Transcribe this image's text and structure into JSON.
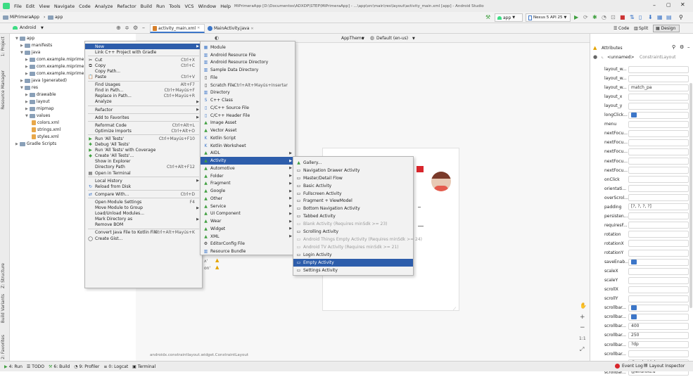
{
  "menubar": {
    "items": [
      "File",
      "Edit",
      "View",
      "Navigate",
      "Code",
      "Analyze",
      "Refactor",
      "Build",
      "Run",
      "Tools",
      "VCS",
      "Window",
      "Help"
    ],
    "title": "MiPrimeraApp [D:\\Documentos\\ADXDP\\STEP\\MiPrimeraApp] - ...\\app\\src\\main\\res\\layout\\activity_main.xml [app] - Android Studio"
  },
  "toolbar": {
    "breadcrumb": [
      "MiPrimeraApp",
      "app"
    ],
    "run_config": "app",
    "device": "Nexus 5 API 25"
  },
  "project": {
    "view_selector": "Android",
    "tree": [
      {
        "label": "app",
        "indent": 0
      },
      {
        "label": "manifests",
        "indent": 1
      },
      {
        "label": "java",
        "indent": 1
      },
      {
        "label": "com.example.miprime",
        "indent": 2
      },
      {
        "label": "com.example.miprime",
        "indent": 2
      },
      {
        "label": "com.example.miprime",
        "indent": 2
      },
      {
        "label": "java (generated)",
        "indent": 1
      },
      {
        "label": "res",
        "indent": 1
      },
      {
        "label": "drawable",
        "indent": 2
      },
      {
        "label": "layout",
        "indent": 2
      },
      {
        "label": "mipmap",
        "indent": 2
      },
      {
        "label": "values",
        "indent": 2
      },
      {
        "label": "colors.xml",
        "indent": 3
      },
      {
        "label": "strings.xml",
        "indent": 3
      },
      {
        "label": "styles.xml",
        "indent": 3
      },
      {
        "label": "Gradle Scripts",
        "indent": 0
      }
    ]
  },
  "tabs": [
    "activity_main.xml",
    "MainActivity.java"
  ],
  "editor": {
    "theme": "AppTheme",
    "locale": "Default (en-us)",
    "views": [
      "Code",
      "Split",
      "Design"
    ],
    "path": "androidx.constraintlayout.widget.ConstraintLayout"
  },
  "attributes": {
    "title": "Attributes",
    "component": "<unnamed>",
    "component_type": "ConstraintLayout",
    "rows": [
      {
        "name": "layout_w...",
        "value": ""
      },
      {
        "name": "layout_w...",
        "value": ""
      },
      {
        "name": "layout_w...",
        "value": "match_pa"
      },
      {
        "name": "layout_x",
        "value": ""
      },
      {
        "name": "layout_y",
        "value": ""
      },
      {
        "name": "longClick...",
        "value": ""
      },
      {
        "name": "menu",
        "value": ""
      },
      {
        "name": "nextFocu...",
        "value": ""
      },
      {
        "name": "nextFocu...",
        "value": ""
      },
      {
        "name": "nextFocu...",
        "value": ""
      },
      {
        "name": "nextFocu...",
        "value": ""
      },
      {
        "name": "nextFocu...",
        "value": ""
      },
      {
        "name": "onClick",
        "value": ""
      },
      {
        "name": "orientati...",
        "value": ""
      },
      {
        "name": "overScrol...",
        "value": ""
      },
      {
        "name": "padding",
        "value": "[?, ?, ?, ?]"
      },
      {
        "name": "persisten...",
        "value": ""
      },
      {
        "name": "requiresF...",
        "value": ""
      },
      {
        "name": "rotation",
        "value": ""
      },
      {
        "name": "rotationX",
        "value": ""
      },
      {
        "name": "rotationY",
        "value": ""
      },
      {
        "name": "saveEnab...",
        "value": ""
      },
      {
        "name": "scaleX",
        "value": ""
      },
      {
        "name": "scaleY",
        "value": ""
      },
      {
        "name": "scrollX",
        "value": ""
      },
      {
        "name": "scrollY",
        "value": ""
      },
      {
        "name": "scrollbar...",
        "value": ""
      },
      {
        "name": "scrollbar...",
        "value": ""
      },
      {
        "name": "scrollbar...",
        "value": "400"
      },
      {
        "name": "scrollbar...",
        "value": "250"
      },
      {
        "name": "scrollbar...",
        "value": "?dp"
      },
      {
        "name": "scrollbar...",
        "value": ""
      },
      {
        "name": "scrollbar...",
        "value": "@android:d"
      },
      {
        "name": "scrollbar...",
        "value": "@android:d"
      }
    ]
  },
  "context_menu": [
    {
      "label": "New",
      "sc": "",
      "sub": true,
      "sel": true
    },
    {
      "label": "Link C++ Project with Gradle",
      "sc": ""
    },
    {
      "sep": true
    },
    {
      "label": "Cut",
      "sc": "Ctrl+X",
      "icon": "✂"
    },
    {
      "label": "Copy",
      "sc": "Ctrl+C",
      "icon": "⧉"
    },
    {
      "label": "Copy Path...",
      "sc": ""
    },
    {
      "label": "Paste",
      "sc": "Ctrl+V",
      "icon": "📋"
    },
    {
      "sep": true
    },
    {
      "label": "Find Usages",
      "sc": "Alt+F7"
    },
    {
      "label": "Find in Path...",
      "sc": "Ctrl+Mayús+F"
    },
    {
      "label": "Replace in Path...",
      "sc": "Ctrl+Mayús+R"
    },
    {
      "label": "Analyze",
      "sc": "",
      "sub": true
    },
    {
      "sep": true
    },
    {
      "label": "Refactor",
      "sc": "",
      "sub": true
    },
    {
      "sep": true
    },
    {
      "label": "Add to Favorites",
      "sc": "",
      "sub": true
    },
    {
      "sep": true
    },
    {
      "label": "Reformat Code",
      "sc": "Ctrl+Alt+L"
    },
    {
      "label": "Optimize Imports",
      "sc": "Ctrl+Alt+O"
    },
    {
      "sep": true
    },
    {
      "label": "Run 'All Tests'",
      "sc": "Ctrl+Mayús+F10",
      "icon": "▶",
      "ic": "green"
    },
    {
      "label": "Debug 'All Tests'",
      "sc": "",
      "icon": "✱",
      "ic": "green"
    },
    {
      "label": "Run 'All Tests' with Coverage",
      "sc": "",
      "icon": "▶",
      "ic": "green"
    },
    {
      "label": "Create 'All Tests'...",
      "sc": "",
      "icon": "◆",
      "ic": "green"
    },
    {
      "label": "Show in Explorer",
      "sc": ""
    },
    {
      "label": "Directory Path",
      "sc": "Ctrl+Alt+F12"
    },
    {
      "label": "Open in Terminal",
      "sc": "",
      "icon": "▤"
    },
    {
      "sep": true
    },
    {
      "label": "Local History",
      "sc": "",
      "sub": true
    },
    {
      "label": "Reload from Disk",
      "sc": "",
      "icon": "↻",
      "ic": "blueic"
    },
    {
      "sep": true
    },
    {
      "label": "Compare With...",
      "sc": "Ctrl+D",
      "icon": "⇄",
      "ic": "blueic"
    },
    {
      "sep": true
    },
    {
      "label": "Open Module Settings",
      "sc": "F4"
    },
    {
      "label": "Move Module to Group",
      "sc": "",
      "sub": true
    },
    {
      "label": "Load/Unload Modules...",
      "sc": ""
    },
    {
      "label": "Mark Directory as",
      "sc": "",
      "sub": true
    },
    {
      "label": "Remove BOM",
      "sc": ""
    },
    {
      "sep": true
    },
    {
      "label": "Convert Java File to Kotlin File",
      "sc": "Ctrl+Alt+Mayús+K"
    },
    {
      "label": "Create Gist...",
      "sc": "",
      "icon": "◯"
    }
  ],
  "new_menu": [
    {
      "label": "Module",
      "icon": "▦",
      "ic": "blueic"
    },
    {
      "label": "Android Resource File",
      "icon": "▥",
      "ic": "blueic"
    },
    {
      "label": "Android Resource Directory",
      "icon": "▥",
      "ic": "blueic"
    },
    {
      "label": "Sample Data Directory",
      "icon": "▥",
      "ic": "blueic"
    },
    {
      "label": "File",
      "icon": "▯"
    },
    {
      "label": "Scratch File",
      "sc": "Ctrl+Alt+Mayús+Insertar",
      "icon": "▯"
    },
    {
      "label": "Directory",
      "icon": "▥",
      "ic": "blueic"
    },
    {
      "label": "C++ Class",
      "icon": "S",
      "ic": "blueic"
    },
    {
      "label": "C/C++ Source File",
      "icon": "▯",
      "ic": "blueic"
    },
    {
      "label": "C/C++ Header File",
      "icon": "▯",
      "ic": "blueic"
    },
    {
      "label": "Image Asset",
      "icon": "▲",
      "ic": "green"
    },
    {
      "label": "Vector Asset",
      "icon": "▲",
      "ic": "green"
    },
    {
      "label": "Kotlin Script",
      "icon": "K",
      "ic": "blueic"
    },
    {
      "label": "Kotlin Worksheet",
      "icon": "K",
      "ic": "blueic"
    },
    {
      "label": "AIDL",
      "icon": "▲",
      "ic": "green",
      "sub": true
    },
    {
      "label": "Activity",
      "icon": "▲",
      "ic": "green",
      "sub": true,
      "sel": true
    },
    {
      "label": "Automotive",
      "icon": "▲",
      "ic": "green",
      "sub": true
    },
    {
      "label": "Folder",
      "icon": "▲",
      "ic": "green",
      "sub": true
    },
    {
      "label": "Fragment",
      "icon": "▲",
      "ic": "green",
      "sub": true
    },
    {
      "label": "Google",
      "icon": "▲",
      "ic": "green",
      "sub": true
    },
    {
      "label": "Other",
      "icon": "▲",
      "ic": "green",
      "sub": true
    },
    {
      "label": "Service",
      "icon": "▲",
      "ic": "green",
      "sub": true
    },
    {
      "label": "UI Component",
      "icon": "▲",
      "ic": "green",
      "sub": true
    },
    {
      "label": "Wear",
      "icon": "▲",
      "ic": "green",
      "sub": true
    },
    {
      "label": "Widget",
      "icon": "▲",
      "ic": "green",
      "sub": true
    },
    {
      "label": "XML",
      "icon": "▲",
      "ic": "green",
      "sub": true
    },
    {
      "label": "EditorConfig File",
      "icon": "⚙"
    },
    {
      "label": "Resource Bundle",
      "icon": "▥",
      "ic": "blueic"
    }
  ],
  "activity_menu": [
    {
      "label": "Gallery...",
      "icon": "▲",
      "ic": "green"
    },
    {
      "label": "Navigation Drawer Activity",
      "icon": "▭"
    },
    {
      "label": "Master/Detail Flow",
      "icon": "▭"
    },
    {
      "label": "Basic Activity",
      "icon": "▭"
    },
    {
      "label": "Fullscreen Activity",
      "icon": "▭"
    },
    {
      "label": "Fragment + ViewModel",
      "icon": "▭"
    },
    {
      "label": "Bottom Navigation Activity",
      "icon": "▭"
    },
    {
      "label": "Tabbed Activity",
      "icon": "▭"
    },
    {
      "label": "Blank Activity (Requires minSdk >= 23)",
      "icon": "▭",
      "dis": true
    },
    {
      "label": "Scrolling Activity",
      "icon": "▭"
    },
    {
      "label": "Android Things Empty Activity (Requires minSdk >= 24)",
      "icon": "▭",
      "dis": true
    },
    {
      "label": "Android TV Activity (Requires minSdk >= 21)",
      "icon": "▭",
      "dis": true
    },
    {
      "label": "Login Activity",
      "icon": "▭"
    },
    {
      "label": "Empty Activity",
      "icon": "▭",
      "sel": true
    },
    {
      "label": "Settings Activity",
      "icon": "▭"
    }
  ],
  "status": {
    "items": [
      "4: Run",
      "TODO",
      "6: Build",
      "9: Profiler",
      "0: Logcat",
      "Terminal"
    ],
    "right": [
      "Event Log",
      "Layout Inspector"
    ]
  },
  "side_tabs": {
    "project": "1: Project",
    "resource": "Resource Manager",
    "structure": "Z: Structure",
    "variants": "Build Variants",
    "favorites": "2: Favorites"
  },
  "colors": {
    "selection": "#2d5dab",
    "accent_red": "#d8262c"
  }
}
